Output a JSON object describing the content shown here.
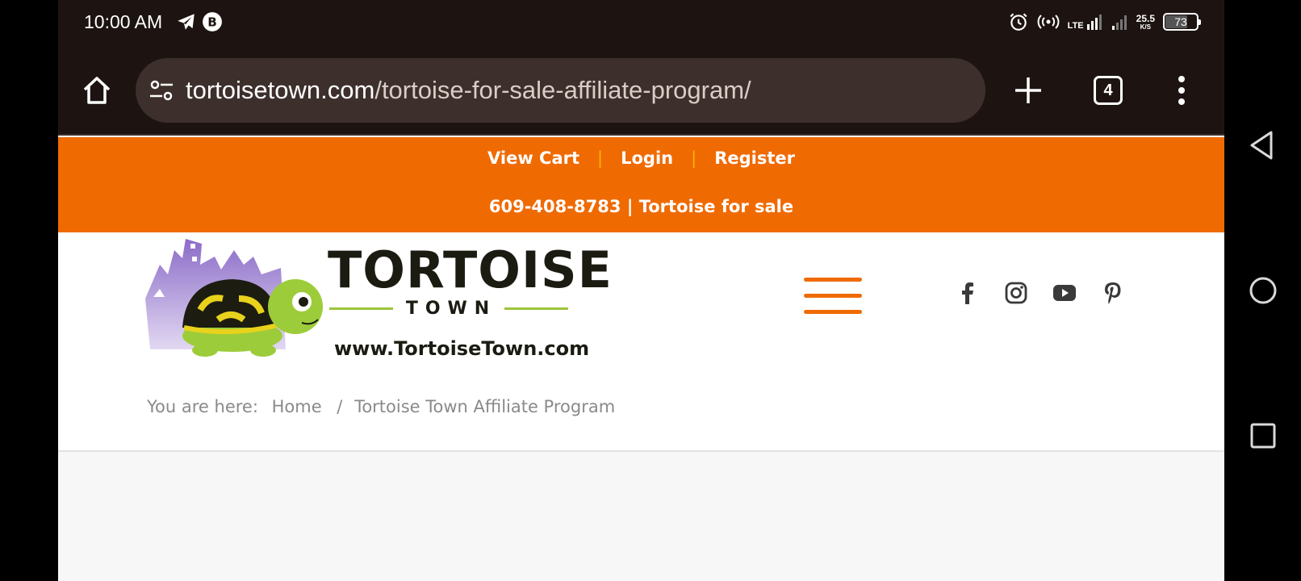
{
  "status_bar": {
    "time": "10:00 AM",
    "left_icons": [
      "telegram-icon",
      "b-circle-icon"
    ],
    "right_icons": [
      "alarm-icon",
      "hotspot-icon",
      "lte-signal-icon",
      "signal-icon"
    ],
    "network": "LTE",
    "speed_value": "25.5",
    "speed_unit": "K/S",
    "battery": "73",
    "battery_level": 0.73
  },
  "browser": {
    "url_host": "tortoisetown.com",
    "url_path": "/tortoise-for-sale-affiliate-program/",
    "tab_count": "4",
    "icons": [
      "home-icon",
      "site-settings-icon",
      "plus-icon",
      "more-vert-icon"
    ]
  },
  "top_bar": {
    "links": [
      "View Cart",
      "Login",
      "Register"
    ],
    "separator": "|",
    "phone_line": "609-408-8783 | Tortoise for sale"
  },
  "logo": {
    "brand": "TORTOISE",
    "sub": "TOWN",
    "url": "www.TortoiseTown.com"
  },
  "social_icons": [
    "facebook-icon",
    "instagram-icon",
    "youtube-icon",
    "pinterest-icon"
  ],
  "breadcrumb": {
    "prefix": "You are here:",
    "home": "Home",
    "separator": "/",
    "current": "Tortoise Town Affiliate Program"
  },
  "colors": {
    "accent_orange": "#f06a02",
    "separator_yellow": "#f4b600",
    "logo_green": "#9dc53a",
    "logo_purple": "#8b6cc8",
    "browser_chrome": "#1d1411"
  }
}
